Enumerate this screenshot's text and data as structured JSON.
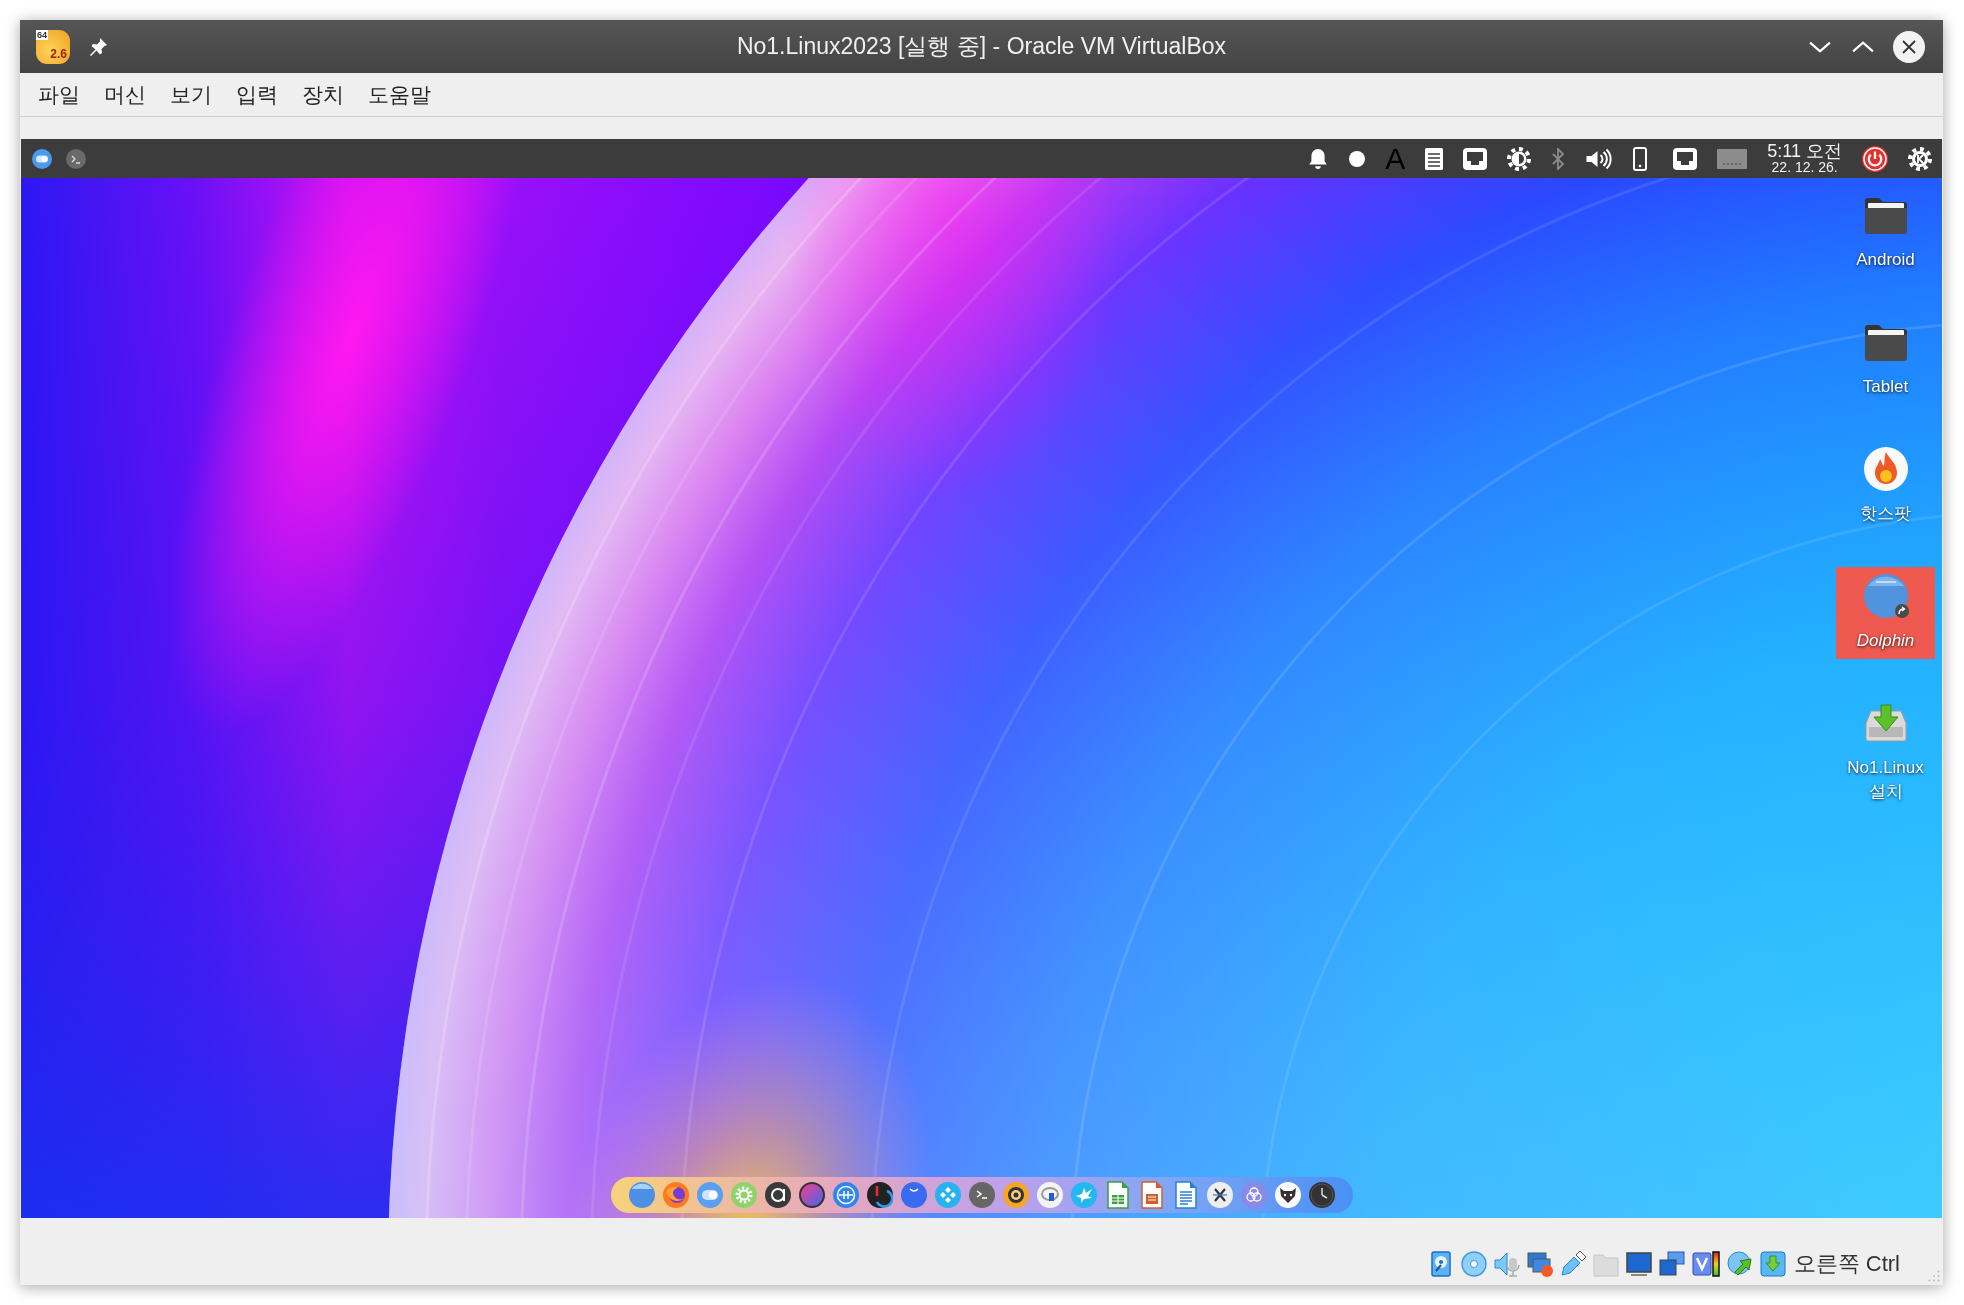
{
  "window": {
    "title": "No1.Linux2023 [실행 중] - Oracle VM VirtualBox",
    "app_icon": {
      "bits": "64",
      "version": "2.6"
    }
  },
  "menu": [
    "파일",
    "머신",
    "보기",
    "입력",
    "장치",
    "도움말"
  ],
  "guest": {
    "panel": {
      "input_indicator": "A",
      "bluetooth_on": false,
      "clock": {
        "time": "5:11 오전",
        "date": "22. 12. 26."
      }
    },
    "desktop_icons": [
      {
        "label": "Android",
        "kind": "folder",
        "selected": false,
        "link": false
      },
      {
        "label": "Tablet",
        "kind": "folder",
        "selected": false,
        "link": false
      },
      {
        "label": "핫스팟",
        "kind": "hotspot",
        "selected": false,
        "link": false
      },
      {
        "label": "Dolphin",
        "kind": "filemanager",
        "selected": true,
        "link": true
      },
      {
        "label": "No1.Linux 설치",
        "kind": "installer",
        "selected": false,
        "link": false
      }
    ]
  },
  "status_bar": {
    "shared_folders_on": false,
    "host_key": "오른쪽 Ctrl"
  }
}
